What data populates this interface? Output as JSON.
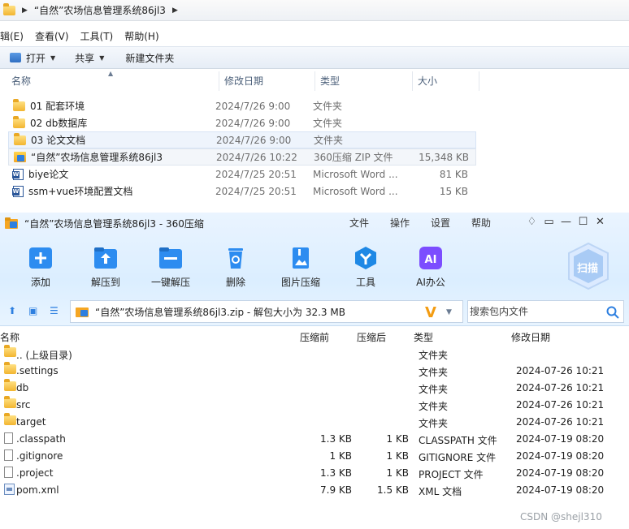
{
  "explorer": {
    "breadcrumb": "“自然”农场信息管理系统86jl3",
    "menu": [
      "辑(E)",
      "查看(V)",
      "工具(T)",
      "帮助(H)"
    ],
    "toolbar": {
      "open": "打开",
      "share": "共享",
      "new_folder": "新建文件夹"
    },
    "columns": {
      "name": "名称",
      "date": "修改日期",
      "type": "类型",
      "size": "大小"
    },
    "rows": [
      {
        "name": "01 配套环境",
        "date": "2024/7/26 9:00",
        "type": "文件夹",
        "size": "",
        "icon": "folder-icon"
      },
      {
        "name": "02 db数据库",
        "date": "2024/7/26 9:00",
        "type": "文件夹",
        "size": "",
        "icon": "folder-icon"
      },
      {
        "name": "03 论文文档",
        "date": "2024/7/26 9:00",
        "type": "文件夹",
        "size": "",
        "icon": "folder-icon"
      },
      {
        "name": "“自然”农场信息管理系统86jl3",
        "date": "2024/7/26 10:22",
        "type": "360压缩 ZIP 文件",
        "size": "15,348 KB",
        "icon": "zip-icon"
      },
      {
        "name": "biye论文",
        "date": "2024/7/25 20:51",
        "type": "Microsoft Word ...",
        "size": "81 KB",
        "icon": "word-icon"
      },
      {
        "name": "ssm+vue环境配置文档",
        "date": "2024/7/25 20:51",
        "type": "Microsoft Word ...",
        "size": "15 KB",
        "icon": "word-icon"
      }
    ]
  },
  "zip": {
    "title": "“自然”农场信息管理系统86jl3 - 360压缩",
    "menu": [
      "文件",
      "操作",
      "设置",
      "帮助"
    ],
    "tools": [
      {
        "label": "添加",
        "icon": "add-icon",
        "color": "#2d8cf0"
      },
      {
        "label": "解压到",
        "icon": "extract-to-icon",
        "color": "#2d8cf0"
      },
      {
        "label": "一键解压",
        "icon": "one-click-extract-icon",
        "color": "#2d8cf0"
      },
      {
        "label": "删除",
        "icon": "recycle-bin-icon",
        "color": "#2d8cf0"
      },
      {
        "label": "图片压缩",
        "icon": "image-compress-icon",
        "color": "#2d8cf0"
      },
      {
        "label": "工具",
        "icon": "tools-icon",
        "color": "#1e88e5"
      },
      {
        "label": "AI办公",
        "icon": "ai-office-icon",
        "color": "#7c4dff"
      }
    ],
    "scan_label": "扫描",
    "path": "“自然”农场信息管理系统86jl3.zip - 解包大小为 32.3 MB",
    "search_placeholder": "搜索包内文件",
    "columns": {
      "name": "名称",
      "size": "压缩前",
      "packed": "压缩后",
      "type": "类型",
      "date": "修改日期"
    },
    "rows": [
      {
        "name": ".. (上级目录)",
        "size": "",
        "packed": "",
        "type": "文件夹",
        "date": "",
        "icon": "folder-icon"
      },
      {
        "name": ".settings",
        "size": "",
        "packed": "",
        "type": "文件夹",
        "date": "2024-07-26 10:21",
        "icon": "folder-icon"
      },
      {
        "name": "db",
        "size": "",
        "packed": "",
        "type": "文件夹",
        "date": "2024-07-26 10:21",
        "icon": "folder-icon"
      },
      {
        "name": "src",
        "size": "",
        "packed": "",
        "type": "文件夹",
        "date": "2024-07-26 10:21",
        "icon": "folder-icon"
      },
      {
        "name": "target",
        "size": "",
        "packed": "",
        "type": "文件夹",
        "date": "2024-07-26 10:21",
        "icon": "folder-icon"
      },
      {
        "name": ".classpath",
        "size": "1.3 KB",
        "packed": "1 KB",
        "type": "CLASSPATH 文件",
        "date": "2024-07-19 08:20",
        "icon": "file-icon"
      },
      {
        "name": ".gitignore",
        "size": "1 KB",
        "packed": "1 KB",
        "type": "GITIGNORE 文件",
        "date": "2024-07-19 08:20",
        "icon": "file-icon"
      },
      {
        "name": ".project",
        "size": "1.3 KB",
        "packed": "1 KB",
        "type": "PROJECT 文件",
        "date": "2024-07-19 08:20",
        "icon": "file-icon"
      },
      {
        "name": "pom.xml",
        "size": "7.9 KB",
        "packed": "1.5 KB",
        "type": "XML 文档",
        "date": "2024-07-19 08:20",
        "icon": "xml-file-icon"
      }
    ]
  },
  "watermark": "CSDN @shejl310"
}
